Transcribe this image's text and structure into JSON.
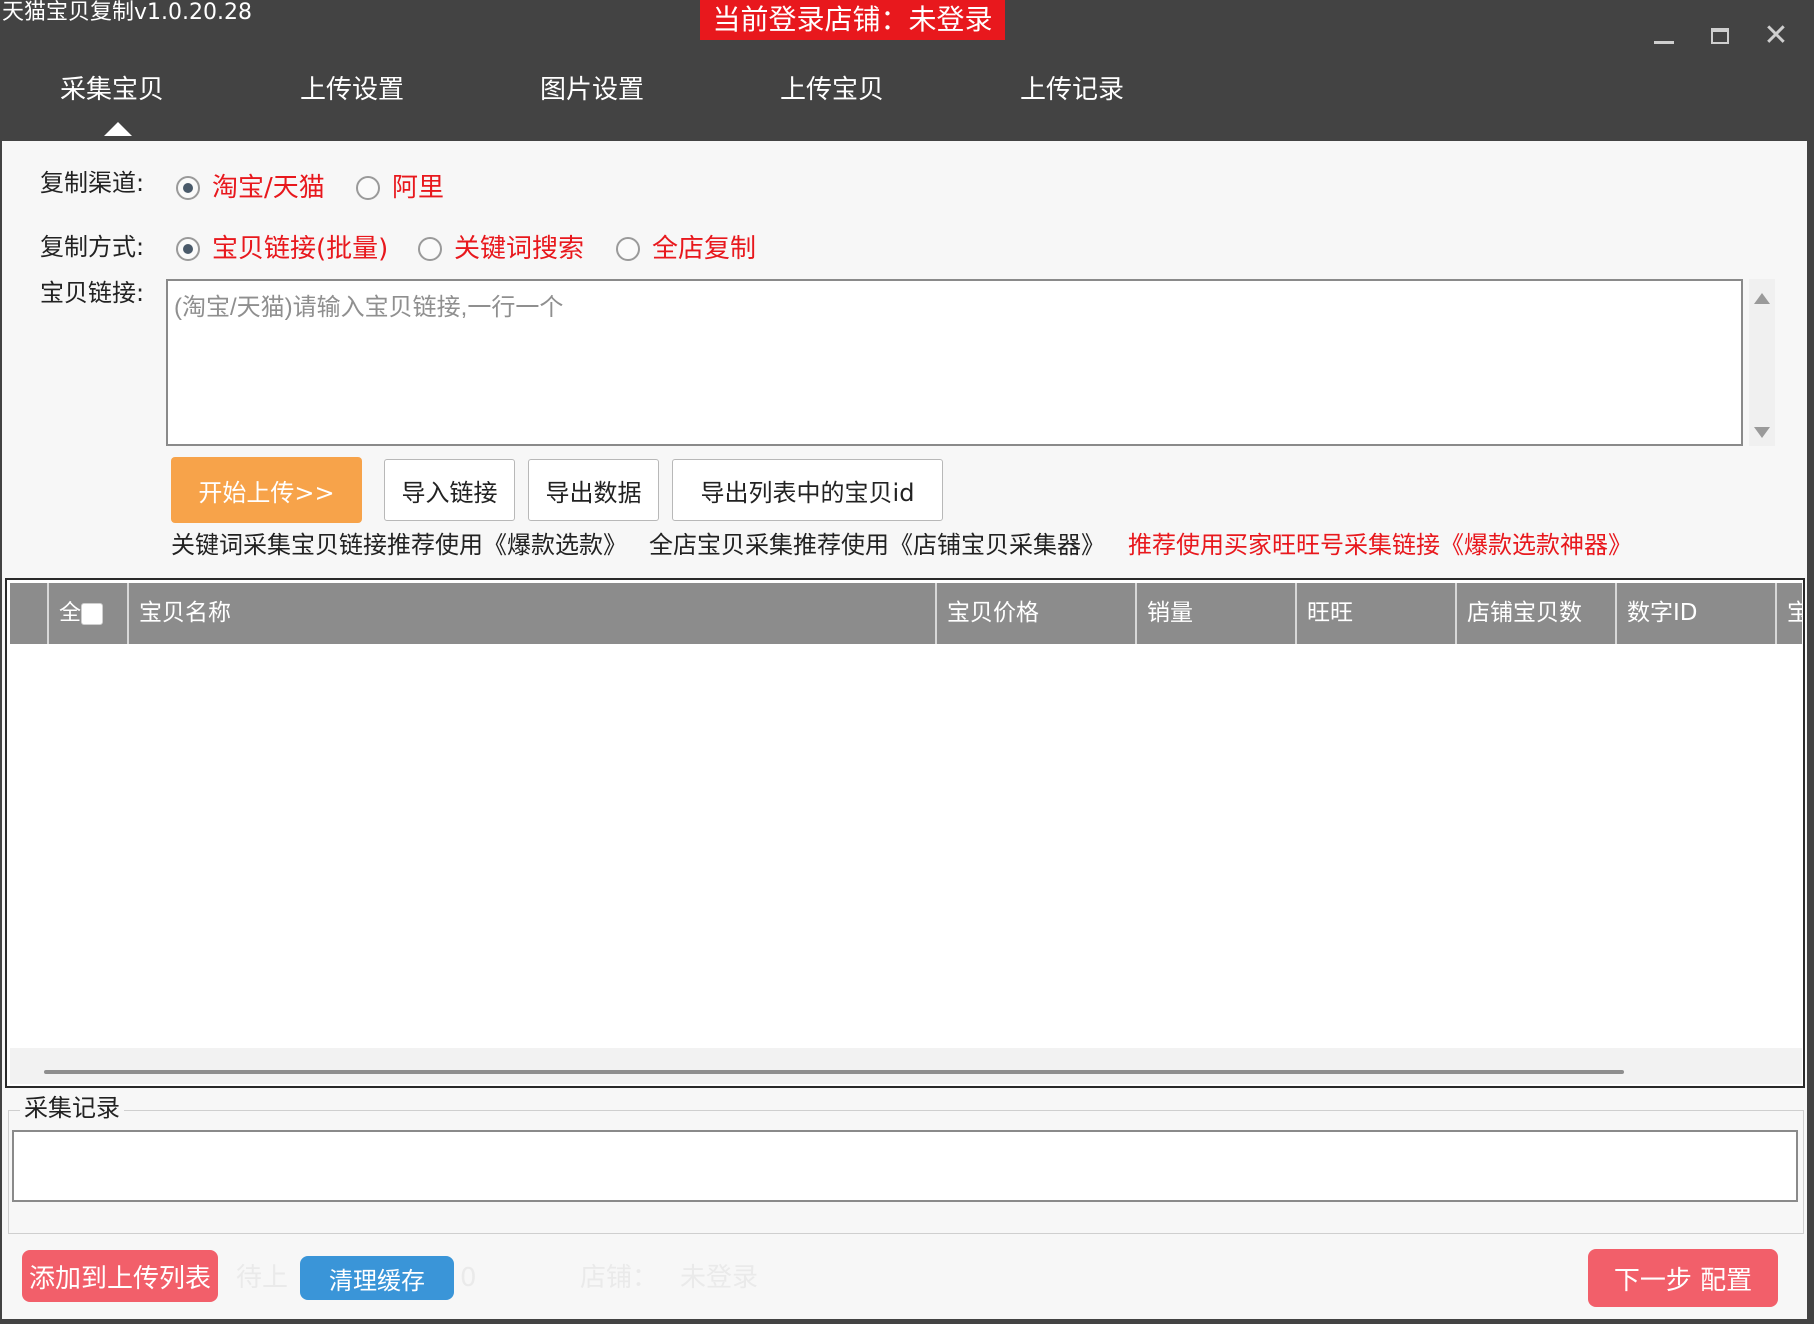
{
  "window": {
    "title": "天猫宝贝复制v1.0.20.28",
    "login_status": "当前登录店铺：未登录"
  },
  "tabs": [
    {
      "label": "采集宝贝",
      "active": true
    },
    {
      "label": "上传设置",
      "active": false
    },
    {
      "label": "图片设置",
      "active": false
    },
    {
      "label": "上传宝贝",
      "active": false
    },
    {
      "label": "上传记录",
      "active": false
    }
  ],
  "form": {
    "channel_label": "复制渠道:",
    "channel_options": [
      {
        "label": "淘宝/天猫",
        "checked": true
      },
      {
        "label": "阿里",
        "checked": false
      }
    ],
    "method_label": "复制方式:",
    "method_options": [
      {
        "label": "宝贝链接(批量)",
        "checked": true
      },
      {
        "label": "关键词搜索",
        "checked": false
      },
      {
        "label": "全店复制",
        "checked": false
      }
    ],
    "link_label": "宝贝链接:",
    "link_placeholder": "(淘宝/天猫)请输入宝贝链接,一行一个",
    "link_value": ""
  },
  "buttons": {
    "start_upload": "开始上传>>",
    "import_links": "导入链接",
    "export_data": "导出数据",
    "export_ids": "导出列表中的宝贝id"
  },
  "hints": {
    "keyword_hint": "关键词采集宝贝链接推荐使用《爆款选款》",
    "shop_hint": "全店宝贝采集推荐使用《店铺宝贝采集器》",
    "buyer_hint": "推荐使用买家旺旺号采集链接《爆款选款神器》"
  },
  "table": {
    "select_all_label": "全",
    "columns": [
      "宝贝名称",
      "宝贝价格",
      "销量",
      "旺旺",
      "店铺宝贝数",
      "数字ID",
      "宝"
    ],
    "rows": []
  },
  "log": {
    "title": "采集记录",
    "content": ""
  },
  "bottom": {
    "add_to_upload": "添加到上传列表",
    "pending_text": "待上",
    "clear_cache": "清理缓存",
    "pending_count": "0",
    "shop_text": "店铺：",
    "shop_value": "未登录",
    "next_config": "下一步 配置"
  },
  "colors": {
    "titlebar_bg": "#434343",
    "login_status_bg": "#e8181d",
    "accent_red_text": "#e8181d",
    "start_button": "#f7a34a",
    "add_button": "#f25f6a",
    "clear_button": "#3a95d8",
    "next_button": "#f25f6a",
    "table_header_bg": "#8c8c8c"
  }
}
